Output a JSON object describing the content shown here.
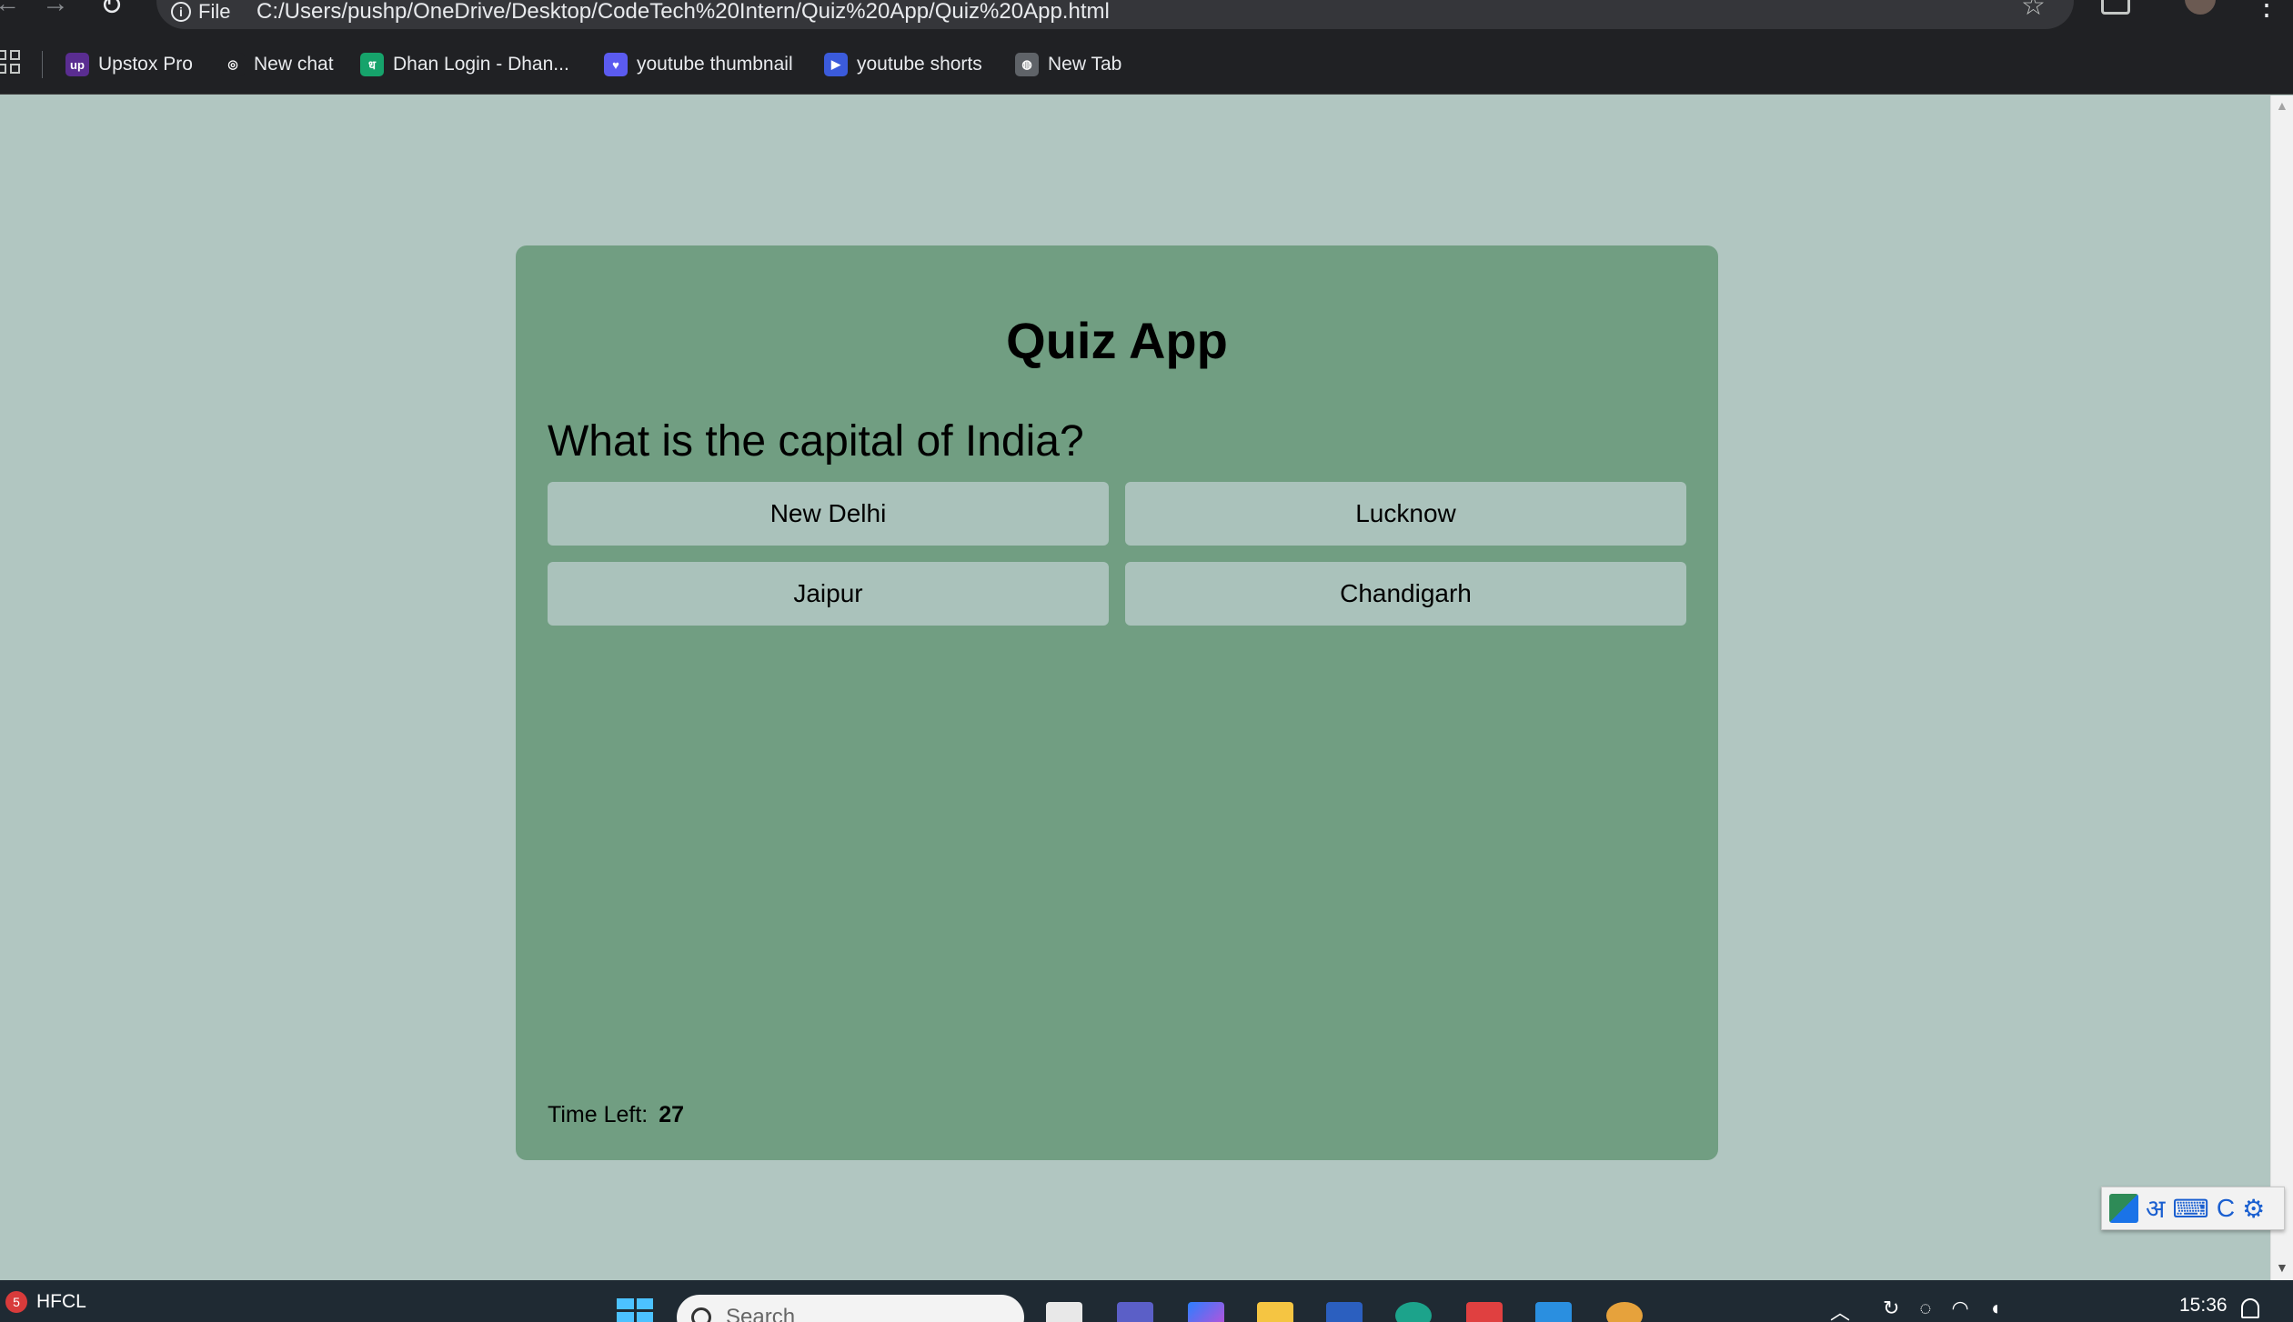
{
  "browser": {
    "url_scheme_label": "File",
    "url": "C:/Users/pushp/OneDrive/Desktop/CodeTech%20Intern/Quiz%20App/Quiz%20App.html",
    "bookmarks": [
      {
        "label": "Upstox Pro",
        "icon": "upstox-icon",
        "icon_text": "up",
        "color": "#5a2d91"
      },
      {
        "label": "New chat",
        "icon": "chatgpt-icon",
        "icon_text": "◎",
        "color": "#202124"
      },
      {
        "label": "Dhan Login - Dhan...",
        "icon": "dhan-icon",
        "icon_text": "ध",
        "color": "#16a36b"
      },
      {
        "label": "youtube thumbnail",
        "icon": "heart-icon",
        "icon_text": "♥",
        "color": "#5b5bf0"
      },
      {
        "label": "youtube shorts",
        "icon": "video-icon",
        "icon_text": "▶",
        "color": "#3b5bdb"
      },
      {
        "label": "New Tab",
        "icon": "globe-icon",
        "icon_text": "◍",
        "color": "#5f6368"
      }
    ]
  },
  "quiz": {
    "title": "Quiz App",
    "question": "What is the capital of India?",
    "answers": [
      "New Delhi",
      "Lucknow",
      "Jaipur",
      "Chandigarh"
    ],
    "timer_label": "Time Left:",
    "timer_value": "27"
  },
  "colors": {
    "page_background": "#b1c6c1",
    "card_background": "#719e82",
    "answer_button": "#aac2bb"
  },
  "language_toolbar": {
    "script_glyph": "अ",
    "c_glyph": "C"
  },
  "taskbar": {
    "weather_badge": "5",
    "weather_label": "HFCL",
    "search_placeholder": "Search",
    "clock": "15:36"
  }
}
